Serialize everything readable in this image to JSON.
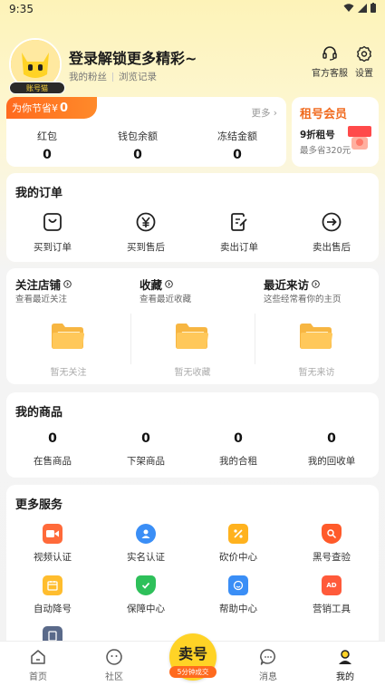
{
  "status_bar": {
    "time": "9:35"
  },
  "header": {
    "avatar_badge": "账号猫",
    "login_title": "登录解锁更多精彩~",
    "links": [
      "我的粉丝",
      "浏览记录"
    ],
    "service_label": "官方客服",
    "settings_label": "设置"
  },
  "savings": {
    "tag_label": "为你节省¥",
    "tag_value": "0",
    "more": "更多",
    "items": [
      {
        "label": "红包",
        "value": "0"
      },
      {
        "label": "钱包余额",
        "value": "0"
      },
      {
        "label": "冻结金额",
        "value": "0"
      }
    ]
  },
  "member": {
    "title": "租号会员",
    "line1": "9折租号",
    "line2": "最多省320元"
  },
  "orders": {
    "title": "我的订单",
    "items": [
      {
        "label": "买到订单",
        "icon": "bag-icon"
      },
      {
        "label": "买到售后",
        "icon": "yen-icon"
      },
      {
        "label": "卖出订单",
        "icon": "edit-doc-icon"
      },
      {
        "label": "卖出售后",
        "icon": "arrow-circle-icon"
      }
    ]
  },
  "follow": [
    {
      "title": "关注店铺",
      "sub": "查看最近关注",
      "empty": "暂无关注"
    },
    {
      "title": "收藏",
      "sub": "查看最近收藏",
      "empty": "暂无收藏"
    },
    {
      "title": "最近来访",
      "sub": "这些经常看你的主页",
      "empty": "暂无来访"
    }
  ],
  "goods": {
    "title": "我的商品",
    "items": [
      {
        "label": "在售商品",
        "value": "0"
      },
      {
        "label": "下架商品",
        "value": "0"
      },
      {
        "label": "我的合租",
        "value": "0"
      },
      {
        "label": "我的回收单",
        "value": "0"
      }
    ]
  },
  "services": {
    "title": "更多服务",
    "items": [
      {
        "label": "视频认证",
        "icon": "video-icon",
        "color": "#ff6a3a"
      },
      {
        "label": "实名认证",
        "icon": "id-user-icon",
        "color": "#3a8ef6"
      },
      {
        "label": "砍价中心",
        "icon": "bargain-icon",
        "color": "#ffb21e"
      },
      {
        "label": "黑号查验",
        "icon": "search-shield-icon",
        "color": "#ff5a2a"
      },
      {
        "label": "自动降号",
        "icon": "calendar-icon",
        "color": "#ffbd2e"
      },
      {
        "label": "保障中心",
        "icon": "shield-check-icon",
        "color": "#2ec05a"
      },
      {
        "label": "帮助中心",
        "icon": "help-face-icon",
        "color": "#3a8ef6"
      },
      {
        "label": "营销工具",
        "icon": "ad-icon",
        "color": "#ff5a3a"
      }
    ]
  },
  "nav": {
    "home": "首页",
    "community": "社区",
    "sell": "卖号",
    "sell_badge": "5分钟成交",
    "messages": "消息",
    "mine": "我的"
  },
  "colors": {
    "accent": "#ff6a1e",
    "brand_yellow": "#ffd326"
  }
}
